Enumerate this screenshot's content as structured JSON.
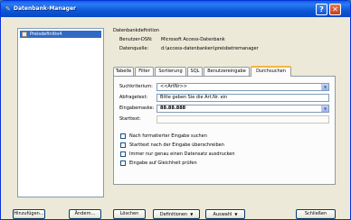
{
  "window": {
    "title": "Datenbank-Manager"
  },
  "datasources": [
    "Preisdefinitio4"
  ],
  "definition": {
    "heading": "Datenbankdefinition",
    "user_dsn_label": "Benutzer-DSN:",
    "user_dsn_value": "Microsoft Access-Datenbank",
    "datasource_label": "Datenquelle:",
    "datasource_value": "d:\\access-datenbanken\\preisbetremanager"
  },
  "tabs": [
    "Tabelle",
    "Filter",
    "Sortierung",
    "SQL",
    "Benutzereingabe",
    "Durchsuchen"
  ],
  "active_tab": "Durchsuchen",
  "form": {
    "search_label": "Suchkriterium:",
    "search_value": "<<ArtNr>>",
    "prompt_label": "Abfragetext:",
    "prompt_value": "Bitte geben Sie die Art.Nr. ein",
    "mask_label": "Eingabemaske:",
    "mask_value": "88.88.888",
    "start_label": "Starttext:",
    "start_value": ""
  },
  "checkboxes": [
    "Nach formatierter Eingabe suchen",
    "Starttext nach der Eingabe überschreiben",
    "Immer nur genau einen Datensatz ausdrucken",
    "Eingabe auf Gleichheit prüfen"
  ],
  "buttons": {
    "add": "Hinzufügen...",
    "change": "Ändern...",
    "delete": "Löschen",
    "definitions": "Definitionen",
    "selection": "Auswahl",
    "close": "Schließen"
  }
}
